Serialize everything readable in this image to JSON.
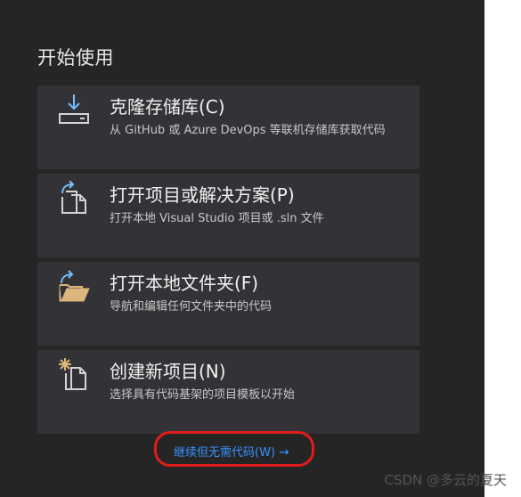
{
  "section_title": "开始使用",
  "cards": [
    {
      "title": "克隆存储库(C)",
      "description": "从 GitHub 或 Azure DevOps 等联机存储库获取代码",
      "icon": "clone-download-icon"
    },
    {
      "title": "打开项目或解决方案(P)",
      "description": "打开本地 Visual Studio 项目或 .sln 文件",
      "icon": "open-project-icon"
    },
    {
      "title": "打开本地文件夹(F)",
      "description": "导航和编辑任何文件夹中的代码",
      "icon": "open-folder-icon"
    },
    {
      "title": "创建新项目(N)",
      "description": "选择具有代码基架的项目模板以开始",
      "icon": "new-project-icon"
    }
  ],
  "continue_link": {
    "label": "继续但无需代码(W)",
    "arrow": "→"
  },
  "watermark": "CSDN @多云的夏天",
  "colors": {
    "panel_bg": "#252526",
    "card_bg": "#333337",
    "link": "#3794ff",
    "annotation": "#e21b1b",
    "icon_blue": "#75beff",
    "folder_yellow": "#dcb67a"
  }
}
